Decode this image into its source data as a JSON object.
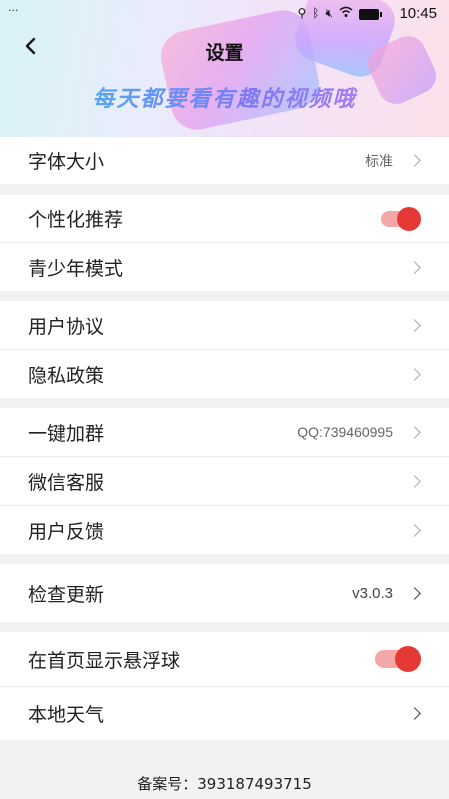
{
  "status_bar": {
    "time": "10:45",
    "dots": "···"
  },
  "header": {
    "title": "设置",
    "slogan": "每天都要看有趣的视频哦"
  },
  "settings": {
    "font_size": {
      "label": "字体大小",
      "value": "标准"
    },
    "personalized": {
      "label": "个性化推荐",
      "enabled": true
    },
    "teen_mode": {
      "label": "青少年模式"
    },
    "user_agreement": {
      "label": "用户协议"
    },
    "privacy_policy": {
      "label": "隐私政策"
    },
    "join_group": {
      "label": "一键加群",
      "value": "QQ:739460995"
    },
    "wechat_service": {
      "label": "微信客服"
    },
    "feedback": {
      "label": "用户反馈"
    },
    "check_update": {
      "label": "检查更新",
      "value": "v3.0.3"
    },
    "floating_ball": {
      "label": "在首页显示悬浮球",
      "enabled": true
    },
    "weather": {
      "label": "本地天气"
    }
  },
  "footer": {
    "record": "备案号：393187493715"
  },
  "colors": {
    "accent": "#e53935",
    "toggle_track": "#f3a7a7",
    "background": "#f2f2f2"
  }
}
